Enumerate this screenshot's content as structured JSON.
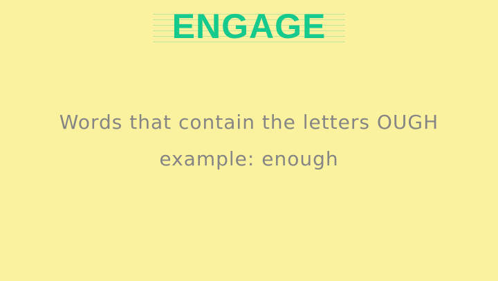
{
  "header": {
    "title": "ENGAGE"
  },
  "prompt": {
    "line1": "Words that contain the letters OUGH",
    "line2": "example: enough"
  },
  "colors": {
    "background": "#fbf29f",
    "title": "#16c98c",
    "text": "#858585",
    "rule_lines": "#bfe4a0"
  }
}
